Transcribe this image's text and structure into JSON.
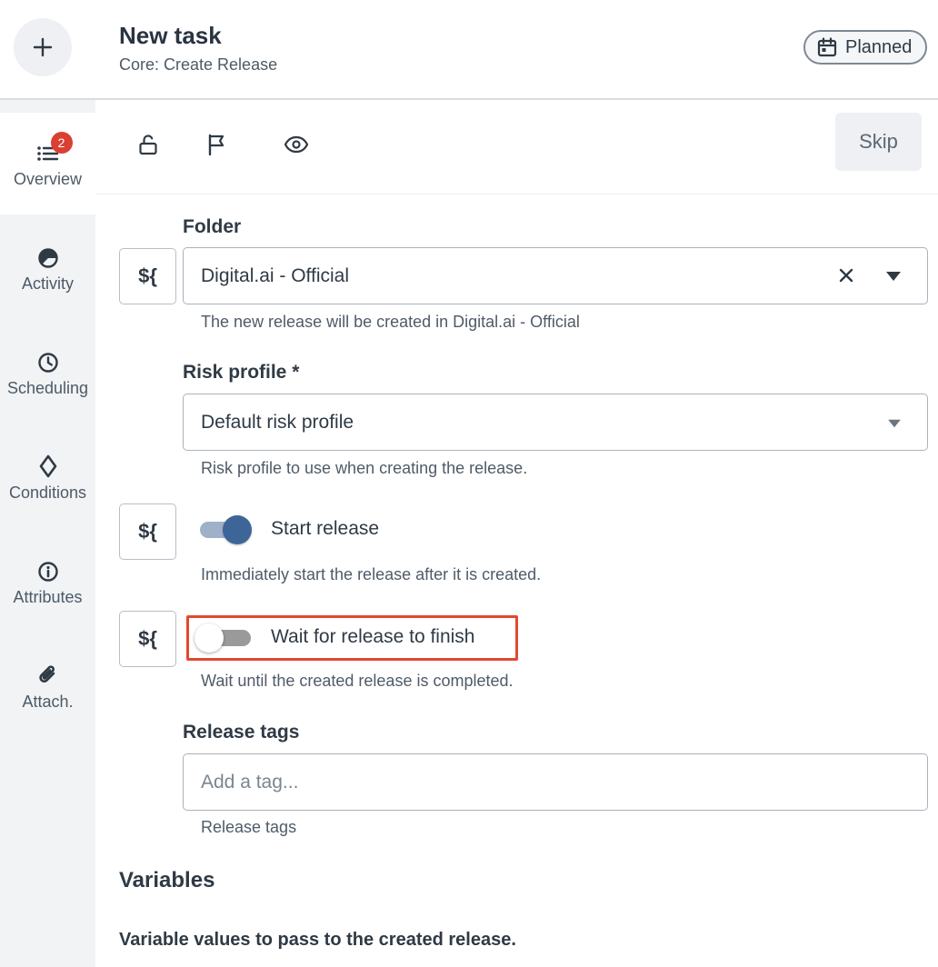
{
  "header": {
    "title": "New task",
    "subtitle": "Core: Create Release",
    "status": "Planned"
  },
  "rail": {
    "items": [
      {
        "label": "Overview",
        "icon": "list-icon",
        "badge": "2",
        "active": true
      },
      {
        "label": "Activity",
        "icon": "pie-icon"
      },
      {
        "label": "Scheduling",
        "icon": "clock-icon"
      },
      {
        "label": "Conditions",
        "icon": "diamond-icon"
      },
      {
        "label": "Attributes",
        "icon": "info-icon"
      },
      {
        "label": "Attach.",
        "icon": "paperclip-icon"
      }
    ]
  },
  "toolbar": {
    "icons": [
      "lock-open-icon",
      "flag-icon",
      "eye-icon"
    ],
    "skip_label": "Skip"
  },
  "form": {
    "variable_button_label": "${",
    "folder": {
      "label": "Folder",
      "value": "Digital.ai - Official",
      "help": "The new release will be created in Digital.ai - Official"
    },
    "risk_profile": {
      "label": "Risk profile *",
      "value": "Default risk profile",
      "help": "Risk profile to use when creating the release."
    },
    "start_release": {
      "label": "Start release",
      "checked": true,
      "help": "Immediately start the release after it is created."
    },
    "wait_for_release": {
      "label": "Wait for release to finish",
      "checked": false,
      "help": "Wait until the created release is completed."
    },
    "release_tags": {
      "label": "Release tags",
      "placeholder": "Add a tag...",
      "help": "Release tags"
    }
  },
  "variables": {
    "title": "Variables",
    "description": "Variable values to pass to the created release."
  },
  "colors": {
    "accent": "#3d6598",
    "highlight": "#e2492f",
    "badge": "#d94032",
    "rail_bg": "#f1f3f5"
  }
}
